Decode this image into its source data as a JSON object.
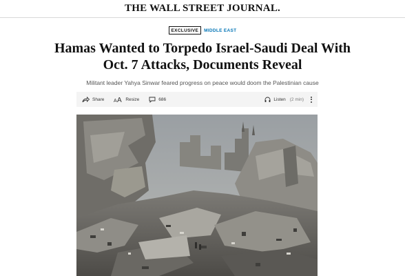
{
  "masthead": {
    "logo_text": "THE WALL STREET JOURNAL."
  },
  "article": {
    "badge": "EXCLUSIVE",
    "section": "MIDDLE EAST",
    "headline_line1": "Hamas Wanted to Torpedo Israel-Saudi Deal With",
    "headline_line2": "Oct. 7 Attacks, Documents Reveal",
    "dek": "Militant leader Yahya Sinwar feared progress on peace would doom the Palestinian cause"
  },
  "toolbar": {
    "share_label": "Share",
    "resize_label": "Resize",
    "comments_count": "686",
    "listen_label": "Listen",
    "listen_duration": "(2 min)"
  },
  "icons": {
    "share": "share-icon",
    "resize": "resize-icon",
    "comments": "comment-icon",
    "listen": "headphones-icon",
    "more": "more-vertical-icon"
  },
  "colors": {
    "section_accent": "#0274b6",
    "toolbar_bg": "#f4f4f4",
    "text": "#111111",
    "dek": "#555555"
  }
}
